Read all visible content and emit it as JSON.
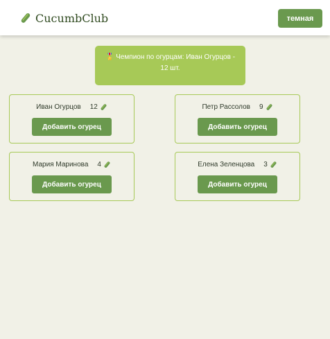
{
  "header": {
    "brand": "CucumbClub",
    "brand_icon": "cucumber-icon",
    "theme_button": "темная"
  },
  "champion": {
    "medal_icon": "medal-icon",
    "medal_glyph": "🎖️",
    "text": "Чемпион по огурцам: Иван Огурцов - 12 шт."
  },
  "players": [
    {
      "name": "Иван Огурцов",
      "count": "12",
      "button": "Добавить огурец"
    },
    {
      "name": "Петр Рассолов",
      "count": "9",
      "button": "Добавить огурец"
    },
    {
      "name": "Мария Маринова",
      "count": "4",
      "button": "Добавить огурец"
    },
    {
      "name": "Елена Зеленцова",
      "count": "3",
      "button": "Добавить огурец"
    }
  ],
  "colors": {
    "background": "#f1f1e7",
    "accent": "#6a994e",
    "light_accent": "#a7c957"
  }
}
